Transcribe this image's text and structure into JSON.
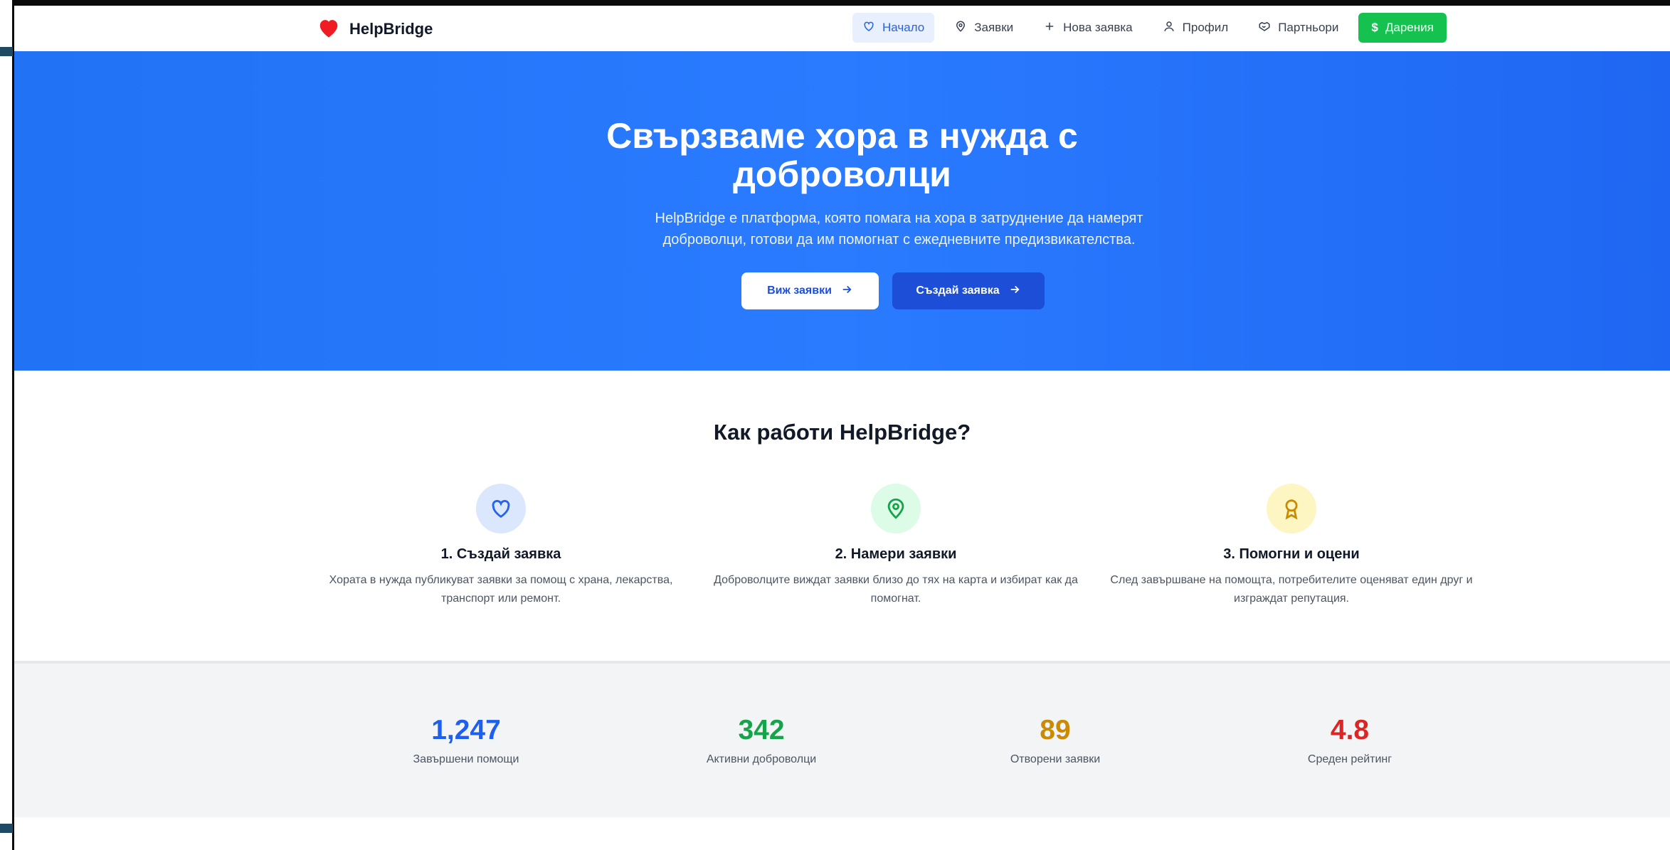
{
  "brand": {
    "name": "HelpBridge"
  },
  "nav": {
    "items": [
      {
        "label": "Начало",
        "icon": "heart-outline-icon"
      },
      {
        "label": "Заявки",
        "icon": "map-pin-icon"
      },
      {
        "label": "Нова заявка",
        "icon": "plus-icon"
      },
      {
        "label": "Профил",
        "icon": "user-icon"
      },
      {
        "label": "Партньори",
        "icon": "handshake-icon"
      },
      {
        "label": "Дарения",
        "icon": "dollar-icon"
      }
    ]
  },
  "hero": {
    "title": "Свързваме хора в нужда с доброволци",
    "subtitle": "HelpBridge е платформа, която помага на хора в затруднение да намерят доброволци, готови да им помогнат с ежедневните предизвикателства.",
    "view_button": "Виж заявки",
    "create_button": "Създай заявка"
  },
  "how": {
    "title": "Как работи HelpBridge?",
    "steps": [
      {
        "title": "1. Създай заявка",
        "desc": "Хората в нужда публикуват заявки за помощ с храна, лекарства, транспорт или ремонт.",
        "icon": "heart-icon"
      },
      {
        "title": "2. Намери заявки",
        "desc": "Доброволците виждат заявки близо до тях на карта и избират как да помогнат.",
        "icon": "map-pin-icon"
      },
      {
        "title": "3. Помогни и оцени",
        "desc": "След завършване на помощта, потребителите оценяват един друг и изграждат репутация.",
        "icon": "award-icon"
      }
    ]
  },
  "stats": [
    {
      "value": "1,247",
      "label": "Завършени помощи",
      "color": "#1d5ff0"
    },
    {
      "value": "342",
      "label": "Активни доброволци",
      "color": "#16a34a"
    },
    {
      "value": "89",
      "label": "Отворени заявки",
      "color": "#ca8a04"
    },
    {
      "value": "4.8",
      "label": "Среден рейтинг",
      "color": "#dc2626"
    }
  ],
  "colors": {
    "primary": "#2563eb",
    "hero": "#2272f5",
    "donate": "#16c24f"
  }
}
